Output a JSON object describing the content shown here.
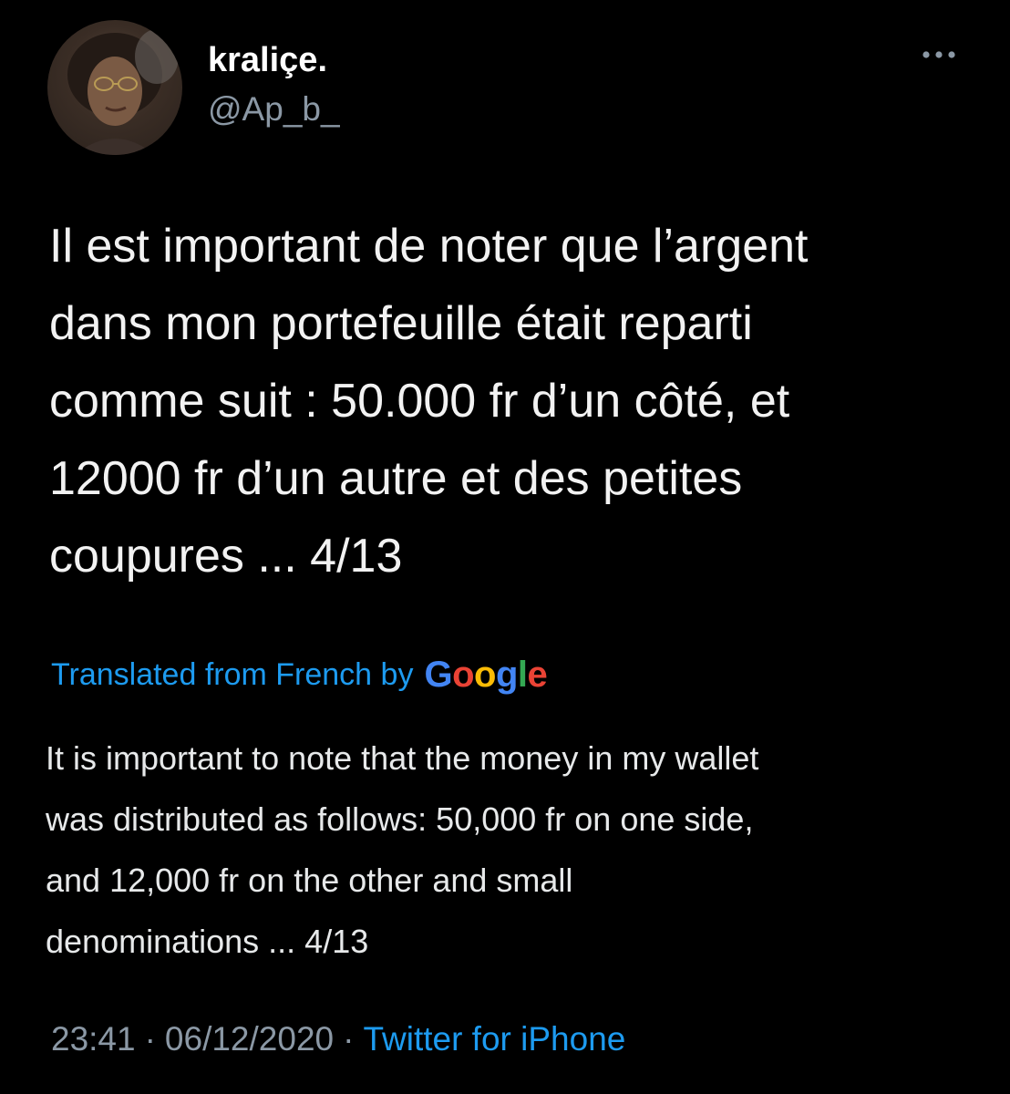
{
  "user": {
    "display_name": "kraliçe.",
    "handle": "@Ap_b_",
    "avatar_icon": "profile-photo"
  },
  "more_icon": "ellipsis-icon",
  "tweet": {
    "lines": [
      "Il est important de noter que l’argent",
      "dans mon portefeuille était reparti",
      "comme suit : 50.000 fr d’un côté, et",
      "12000 fr d’un autre et des petites",
      "coupures ... 4/13"
    ]
  },
  "translation": {
    "label": "Translated from French by",
    "provider": [
      "G",
      "o",
      "o",
      "g",
      "l",
      "e"
    ],
    "provider_colors": [
      "#4285F4",
      "#EA4335",
      "#FBBC05",
      "#4285F4",
      "#34A853",
      "#EA4335"
    ],
    "lines": [
      "It is important to note that the money in my wallet",
      "was distributed as follows: 50,000 fr on one side,",
      "and 12,000 fr on the other and small",
      "denominations ... 4/13"
    ]
  },
  "meta": {
    "time": "23:41",
    "date": "06/12/2020",
    "source": "Twitter for iPhone",
    "separator": "·"
  },
  "colors": {
    "background": "#000000",
    "accent": "#1d9bf0",
    "secondary_text": "#8b98a5"
  }
}
